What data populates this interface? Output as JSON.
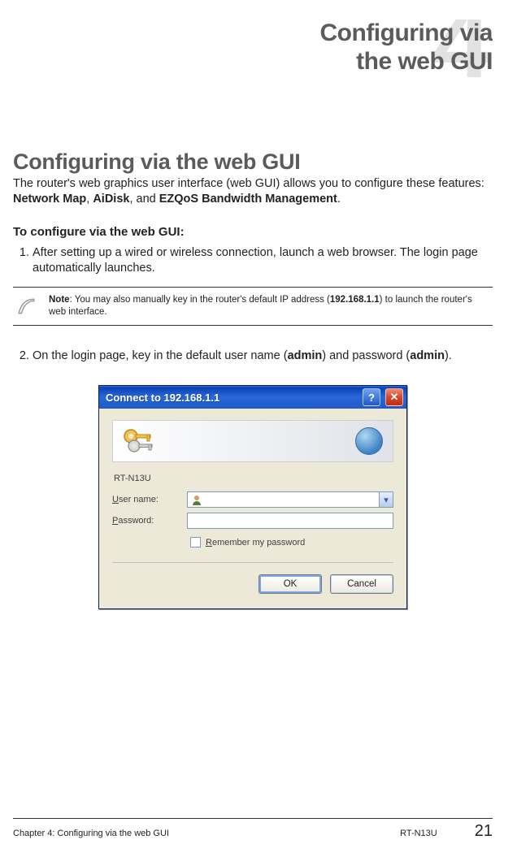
{
  "chapter": {
    "number": "4",
    "title_line1": "Configuring via",
    "title_line2": "the web GUI"
  },
  "section": {
    "title": "Configuring via the web GUI",
    "intro_prefix": "The router's web graphics user interface (web GUI) allows you to configure these features: ",
    "feature1": "Network Map",
    "sep1": ", ",
    "feature2": "AiDisk",
    "sep2": ", and ",
    "feature3": "EZQoS Bandwidth Management",
    "intro_suffix": "."
  },
  "howto": {
    "heading": "To configure via the web GUI:",
    "step1": "After setting up a wired or wireless connection, launch a web browser. The login page automatically launches.",
    "step2_prefix": "On the login page, key in the default user name (",
    "step2_user": "admin",
    "step2_mid": ") and password (",
    "step2_pass": "admin",
    "step2_suffix": ")."
  },
  "note": {
    "label": "Note",
    "text_before": ": You may also manually key in the router's default IP address (",
    "ip": "192.168.1.1",
    "text_after": ") to launch the router's web interface."
  },
  "dialog": {
    "title": "Connect to 192.168.1.1",
    "help_glyph": "?",
    "close_glyph": "✕",
    "device": "RT-N13U",
    "username_label_u": "U",
    "username_label_rest": "ser name:",
    "username_value": "",
    "password_label_u": "P",
    "password_label_rest": "assword:",
    "password_value": "",
    "remember_u": "R",
    "remember_rest": "emember my password",
    "ok": "OK",
    "cancel": "Cancel",
    "dropdown_glyph": "▾"
  },
  "footer": {
    "chapter": "Chapter 4: Configuring via the web GUI",
    "model": "RT-N13U",
    "page": "21"
  }
}
